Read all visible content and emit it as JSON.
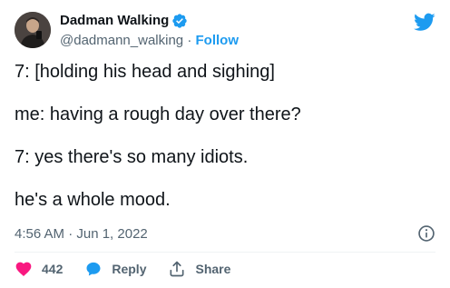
{
  "author": {
    "display_name": "Dadman Walking",
    "handle": "@dadmann_walking",
    "separator": "·",
    "follow_label": "Follow"
  },
  "body": {
    "lines": [
      "7: [holding his head and sighing]",
      "me: having a rough day over there?",
      "7: yes there's so many idiots.",
      "he's a whole mood."
    ]
  },
  "meta": {
    "timestamp": "4:56 AM · Jun 1, 2022"
  },
  "actions": {
    "like_count": "442",
    "reply_label": "Reply",
    "share_label": "Share"
  },
  "icons": {
    "verified": "verified-badge-icon",
    "twitter": "twitter-bird-icon",
    "info": "info-icon",
    "like": "heart-icon",
    "reply": "reply-bubble-icon",
    "share": "share-upload-icon"
  },
  "colors": {
    "accent": "#1d9bf0",
    "like": "#f91880",
    "text": "#0f1419",
    "muted": "#536471"
  }
}
